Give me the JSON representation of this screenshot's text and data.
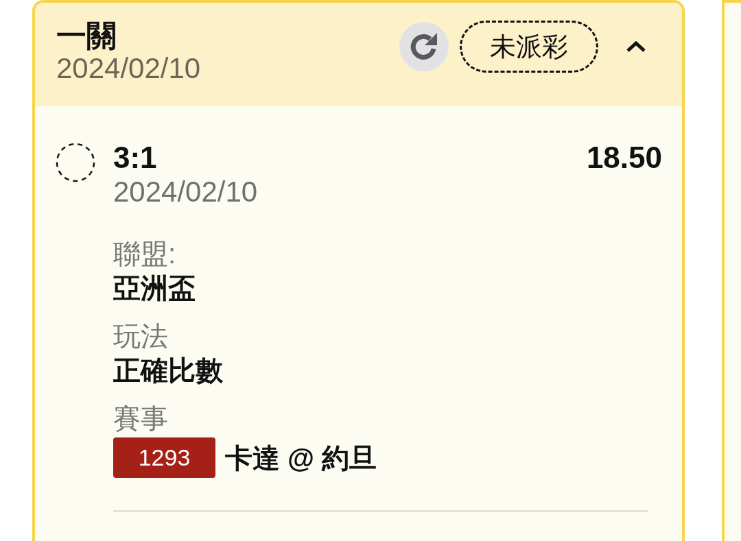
{
  "bet_card": {
    "title": "一關",
    "date": "2024/02/10",
    "status": "未派彩",
    "expanded": true,
    "legs": [
      {
        "selection": "3:1",
        "date": "2024/02/10",
        "odds": "18.50",
        "details": [
          {
            "label": "聯盟:",
            "value": "亞洲盃"
          },
          {
            "label": "玩法",
            "value": "正確比數"
          }
        ],
        "event": {
          "label": "賽事",
          "number": "1293",
          "teams": "卡達 @ 約旦"
        }
      }
    ]
  }
}
